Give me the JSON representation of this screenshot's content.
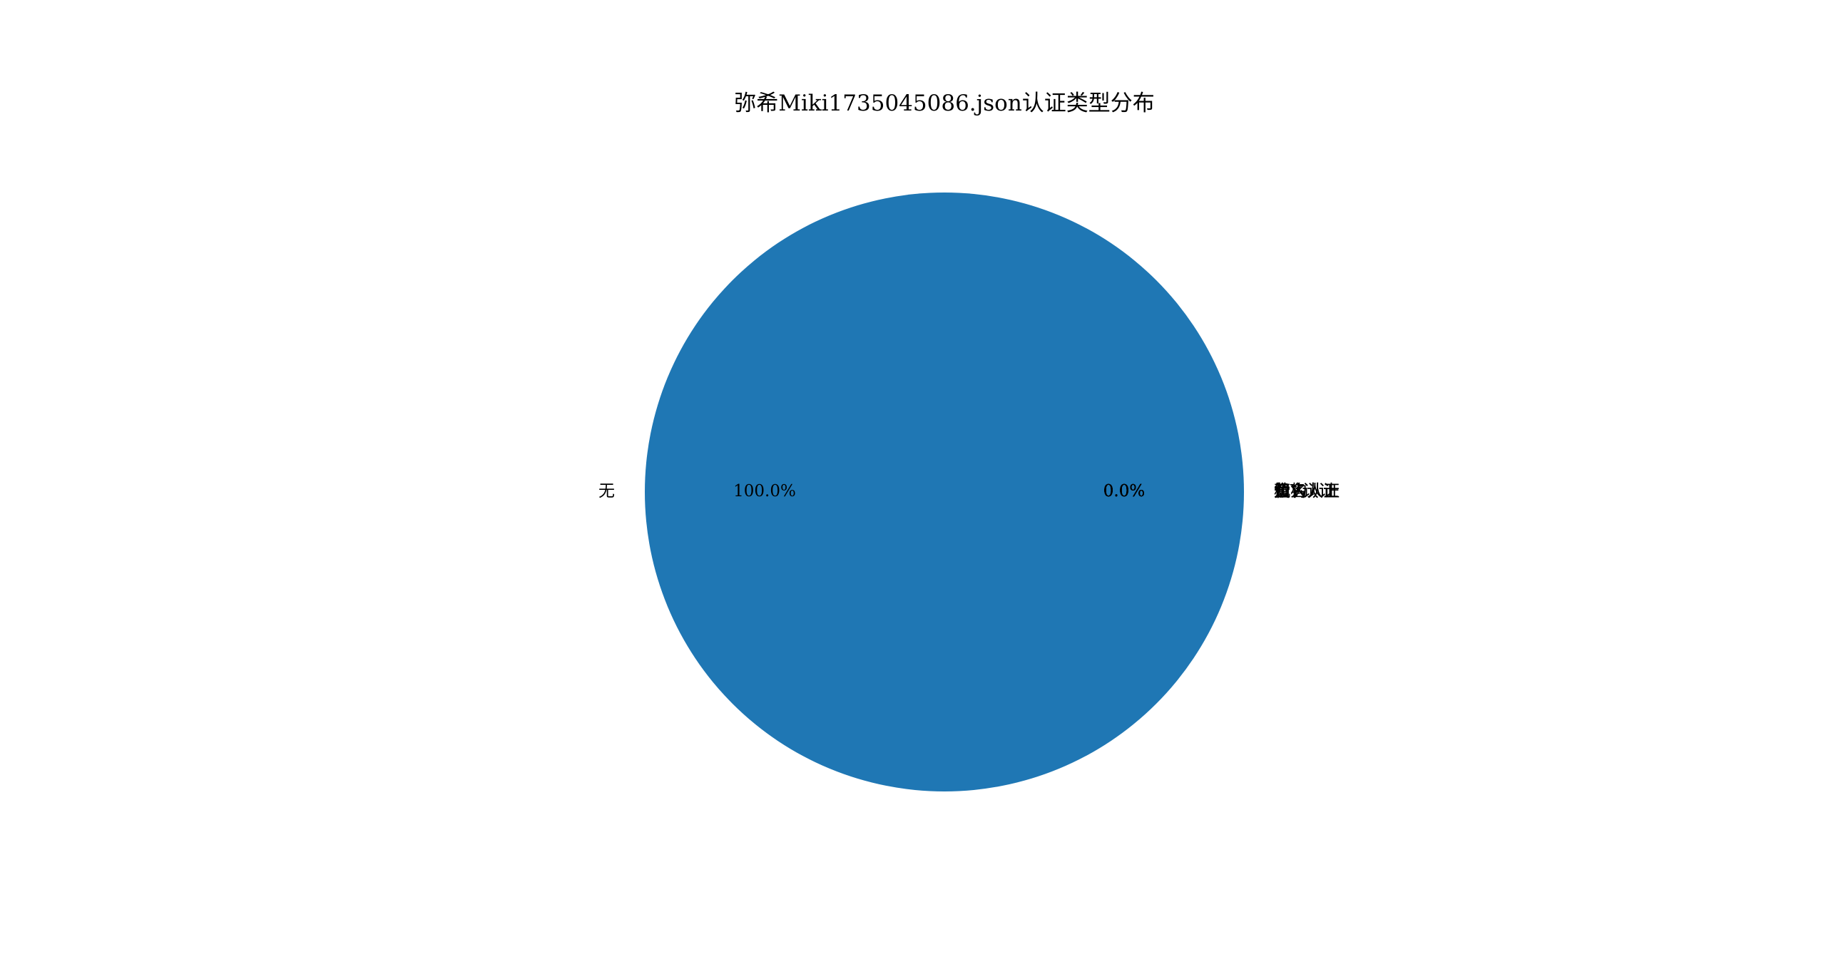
{
  "chart_data": {
    "type": "pie",
    "title": "弥希Miki1735045086.json认证类型分布",
    "categories": [
      "无",
      "黄V认证",
      "蓝V认证",
      "金V认证",
      "个人认证",
      "机构认证",
      "知名人士"
    ],
    "values": [
      100,
      0,
      0,
      0,
      0,
      0,
      0
    ],
    "percent_labels": [
      "100.0%",
      "0.0%",
      "0.0%",
      "0.0%",
      "0.0%",
      "0.0%",
      "0.0%"
    ],
    "colors": [
      "#1f77b4",
      "#ff7f0e",
      "#2ca02c",
      "#d62728",
      "#9467bd",
      "#8c564b",
      "#e377c2"
    ],
    "legend": "none"
  }
}
